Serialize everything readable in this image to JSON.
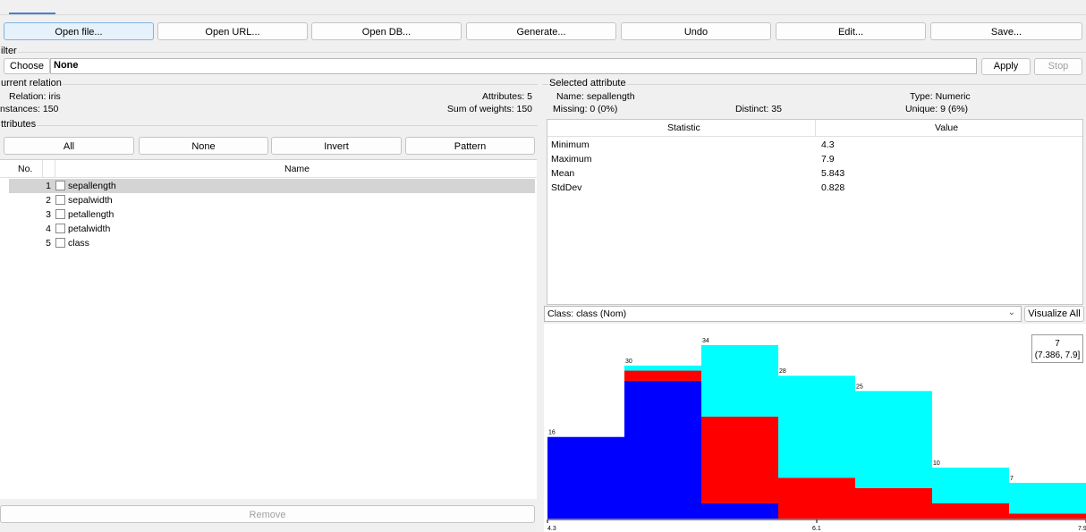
{
  "toolbar": {
    "open_file": "Open file...",
    "open_url": "Open URL...",
    "open_db": "Open DB...",
    "generate": "Generate...",
    "undo": "Undo",
    "edit": "Edit...",
    "save": "Save..."
  },
  "filter": {
    "legend": "ilter",
    "choose_label": "Choose",
    "value": "None",
    "apply_label": "Apply",
    "stop_label": "Stop"
  },
  "current_relation": {
    "legend": "urrent relation",
    "relation": "Relation: iris",
    "instances": "nstances: 150",
    "attributes": "Attributes: 5",
    "sum_weights": "Sum of weights: 150"
  },
  "attributes": {
    "legend": "ttributes",
    "all_label": "All",
    "none_label": "None",
    "invert_label": "Invert",
    "pattern_label": "Pattern",
    "col_no": "No.",
    "col_name": "Name",
    "items": [
      {
        "no": "1",
        "name": "sepallength"
      },
      {
        "no": "2",
        "name": "sepalwidth"
      },
      {
        "no": "3",
        "name": "petallength"
      },
      {
        "no": "4",
        "name": "petalwidth"
      },
      {
        "no": "5",
        "name": "class"
      }
    ],
    "remove_label": "Remove"
  },
  "selected_attribute": {
    "legend": "Selected attribute",
    "name": "Name: sepallength",
    "missing": "Missing: 0 (0%)",
    "distinct": "Distinct: 35",
    "type": "Type: Numeric",
    "unique": "Unique: 9 (6%)",
    "col_statistic": "Statistic",
    "col_value": "Value",
    "stats": [
      {
        "k": "Minimum",
        "v": "4.3"
      },
      {
        "k": "Maximum",
        "v": "7.9"
      },
      {
        "k": "Mean",
        "v": "5.843"
      },
      {
        "k": "StdDev",
        "v": "0.828"
      }
    ]
  },
  "class_select": {
    "value": "Class: class (Nom)",
    "visualize_all": "Visualize All"
  },
  "tooltip": {
    "count": "7",
    "range": "(7.386, 7.9]"
  },
  "chart_data": {
    "type": "bar",
    "stacked": true,
    "x_ticks": [
      "4.3",
      "6.1",
      "7.9"
    ],
    "categories": [
      "[4.3, 4.814]",
      "(4.814, 5.329]",
      "(5.329, 5.843]",
      "(5.843, 6.357]",
      "(6.357, 6.871]",
      "(6.871, 7.386]",
      "(7.386, 7.9]"
    ],
    "totals": [
      16,
      30,
      34,
      28,
      25,
      10,
      7
    ],
    "series": [
      {
        "color": "#0000ff",
        "values": [
          16,
          27,
          3,
          0,
          0,
          0,
          0
        ]
      },
      {
        "color": "#ff0000",
        "values": [
          0,
          2,
          17,
          8,
          6,
          3,
          1
        ]
      },
      {
        "color": "#00ffff",
        "values": [
          0,
          1,
          14,
          20,
          19,
          7,
          6
        ]
      }
    ],
    "ylim": [
      0,
      34
    ]
  }
}
